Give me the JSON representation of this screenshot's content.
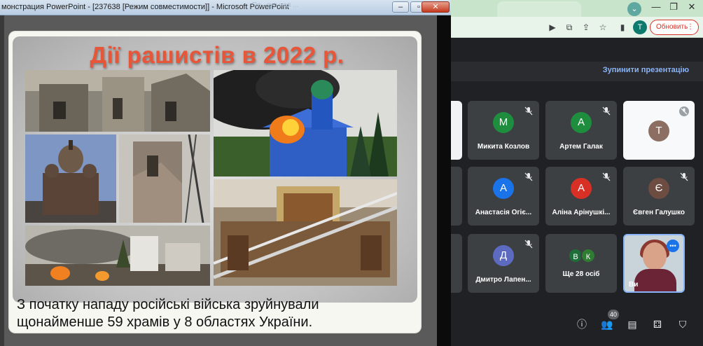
{
  "powerpoint": {
    "window_title": "монстрация PowerPoint - [237638 [Режим совместимости]] - Microsoft PowerPoint",
    "ghost_text": "Пе...зуп ная ...",
    "slide": {
      "title": "Дії рашистів в 2022 р.",
      "caption_line1": "З початку нападу російські війська зруйнували",
      "caption_line2": "щонайменше 59 храмів у 8 областях України."
    }
  },
  "chrome": {
    "profile_initial": "T",
    "update_label": "Обновить",
    "tab_badge_icon": "chevron-down-icon"
  },
  "meet": {
    "stop_presenting": "Зупинити презентацію",
    "participants": [
      {
        "name": "Микита Козлов",
        "initial": "М",
        "color": "#1e8e3e",
        "muted": true
      },
      {
        "name": "Артем Галак",
        "initial": "А",
        "color": "#1e8e3e",
        "muted": true
      },
      {
        "name": "",
        "initial": "Т",
        "color": "#8d6e63",
        "muted": true
      },
      {
        "name": "Анастасія Огіє...",
        "initial": "А",
        "color": "#1a73e8",
        "muted": true
      },
      {
        "name": "Аліна Арінушкі...",
        "initial": "А",
        "color": "#d93025",
        "muted": true
      },
      {
        "name": "Євген Галушко",
        "initial": "Є",
        "color": "#6d4c41",
        "muted": true
      },
      {
        "name": "Дмитро Лапен...",
        "initial": "Д",
        "color": "#5c6bc0",
        "muted": true
      }
    ],
    "more": {
      "label": "Ще 28 осіб",
      "initials": [
        "В",
        "К"
      ]
    },
    "self_name": "Ви",
    "people_count": "40",
    "controls": [
      "info-icon",
      "people-icon",
      "chat-icon",
      "activities-icon",
      "host-controls-icon"
    ]
  }
}
